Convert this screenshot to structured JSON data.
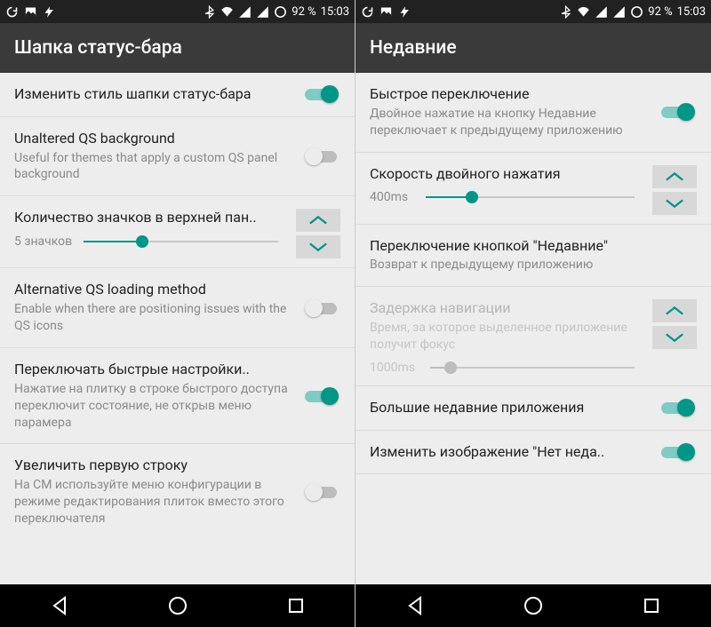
{
  "accent": "#009688",
  "statusbar": {
    "battery": "92 %",
    "time": "15:03"
  },
  "left": {
    "title": "Шапка статус-бара",
    "rows": [
      {
        "title": "Изменить стиль шапки статус-бара",
        "toggle": true
      },
      {
        "title": "Unaltered QS background",
        "sub": "Useful for themes that apply a custom QS panel background",
        "toggle": false
      },
      {
        "title": "Количество значков в верхней пан..",
        "slider_label": "5 значков",
        "slider_pct": 30,
        "stepper": true
      },
      {
        "title": "Alternative QS loading method",
        "sub": "Enable when there are positioning issues with the QS icons",
        "toggle": false
      },
      {
        "title": "Переключать быстрые настройки..",
        "sub": "Нажатие на плитку в строке быстрого доступа переключит состояние, не открыв меню парамера",
        "toggle": true
      },
      {
        "title": "Увеличить первую строку",
        "sub": "На CM используйте меню конфигурации в режиме редактирования плиток вместо этого переключателя",
        "toggle": false
      }
    ]
  },
  "right": {
    "title": "Недавние",
    "rows": [
      {
        "title": "Быстрое переключение",
        "sub": "Двойное нажатие на кнопку Недавние переключает к предыдущему приложению",
        "toggle": true
      },
      {
        "title": "Скорость двойного нажатия",
        "slider_label": "400ms",
        "slider_pct": 22,
        "stepper": true
      },
      {
        "title": "Переключение кнопкой \"Недавние\"",
        "sub": "Возврат к предыдущему приложению"
      },
      {
        "title": "Задержка навигации",
        "sub": "Время, за которое выделенное приложение получит фокус",
        "slider_label": "1000ms",
        "slider_pct": 10,
        "stepper": true,
        "disabled": true
      },
      {
        "title": "Большие недавние приложения",
        "toggle": true
      },
      {
        "title": "Изменить изображение \"Нет неда..",
        "toggle": true
      }
    ]
  }
}
